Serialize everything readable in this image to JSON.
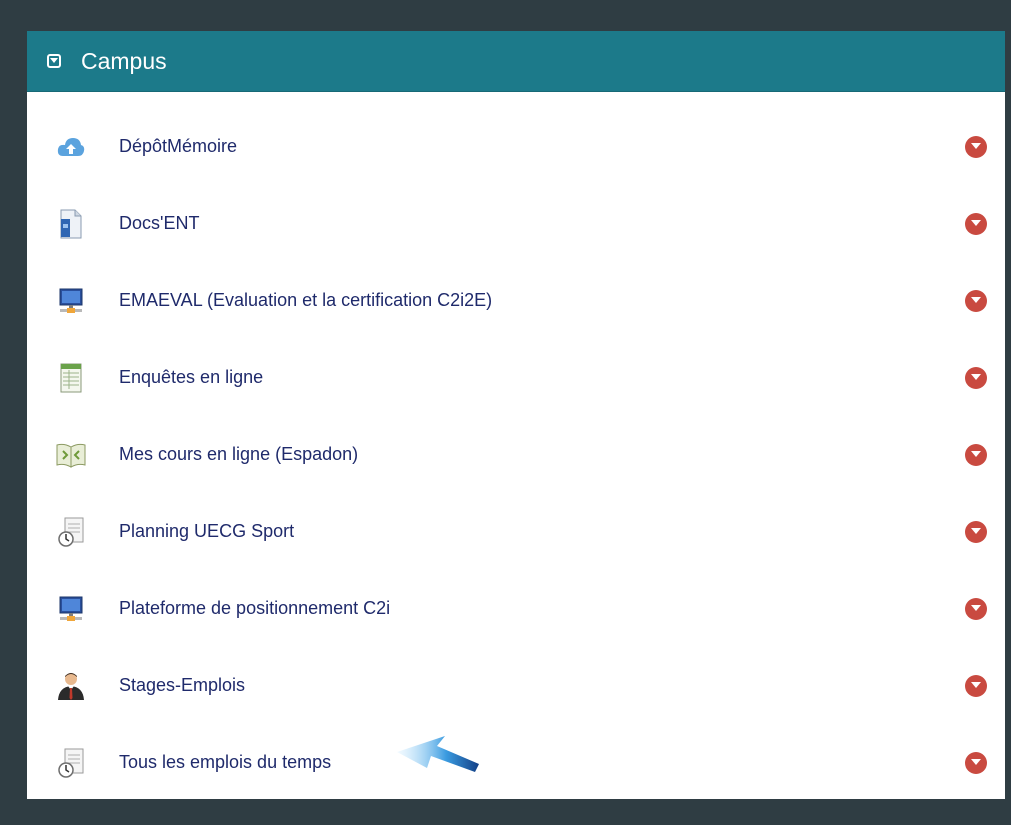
{
  "panel": {
    "title": "Campus",
    "toggle_icon": "chevron-down-square-icon",
    "header_color": "#1c7a8a",
    "items": [
      {
        "label": "DépôtMémoire",
        "icon": "cloud-upload-icon"
      },
      {
        "label": "Docs'ENT",
        "icon": "document-icon"
      },
      {
        "label": "EMAEVAL (Evaluation et la certification C2i2E)",
        "icon": "computer-network-icon"
      },
      {
        "label": "Enquêtes en ligne",
        "icon": "spreadsheet-icon"
      },
      {
        "label": "Mes cours en ligne (Espadon)",
        "icon": "open-book-icon"
      },
      {
        "label": "Planning UECG Sport",
        "icon": "schedule-clock-icon"
      },
      {
        "label": "Plateforme de positionnement C2i",
        "icon": "computer-network-icon"
      },
      {
        "label": "Stages-Emplois",
        "icon": "businessman-icon"
      },
      {
        "label": "Tous les emplois du temps",
        "icon": "schedule-clock-icon"
      }
    ],
    "item_action_icon": "chevron-down-circle-icon",
    "badge_color": "#c94a40"
  },
  "annotation": {
    "icon": "arrow-pointer-icon"
  }
}
